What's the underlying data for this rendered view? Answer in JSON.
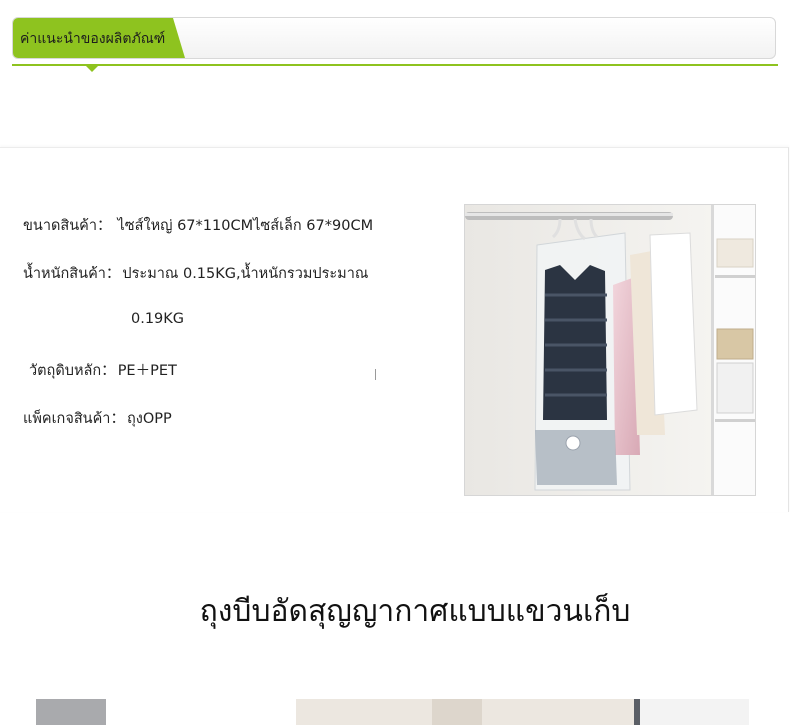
{
  "header": {
    "title": "ค่าแนะนำของผลิตภัณฑ์"
  },
  "specs": [
    {
      "label": "ขนาดสินค้า：",
      "value": "ไซส์ใหญ่ 67*110CMไซส์เล็ก 67*90CM"
    },
    {
      "label": "น้ำหนักสินค้า：",
      "value": "ประมาณ 0.15KG,น้ำหนักรวมประมาณ"
    },
    {
      "label": "",
      "value": "0.19KG"
    },
    {
      "label": "วัตถุดิบหลัก：",
      "value": "PE＋PET"
    },
    {
      "label": "แพ็คเกจสินค้า：",
      "value": "ถุงOPP"
    }
  ],
  "section": {
    "title": "ถุงบีบอัดสุญญากาศแบบแขวนเก็บ"
  },
  "colors": {
    "accent": "#8ec31f",
    "border": "#d8d8d8"
  },
  "images": {
    "product_photo": "vacuum-hanging-bags-photo",
    "bottom_photo": "bottom-product-photo"
  }
}
